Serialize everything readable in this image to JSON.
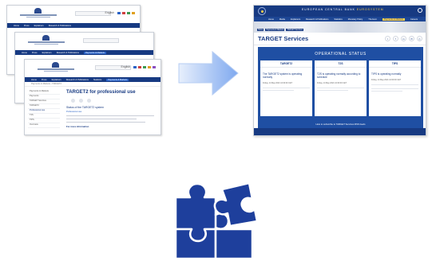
{
  "old_site": {
    "bank_name": "EUROPEAN CENTRAL BANK",
    "bank_subtitle": "EUROSYSTEM",
    "language": "English",
    "nav": [
      "Home",
      "Press",
      "Explainers",
      "Research & Publications",
      "Statistics",
      "Monetary Policy",
      "The Euro",
      "Payments & Markets",
      "Careers"
    ],
    "breadcrumb": "Payments & Markets › TARGET2",
    "sidebar": [
      "Payments & Markets",
      "Payments",
      "TARGET Services",
      "TARGET2",
      "Profile",
      "Professional use",
      "T2S",
      "TIPS",
      "Overview"
    ],
    "title": "TARGET2 for professional use",
    "status_heading": "Status of the TARGET2 system",
    "status_link": "Professional use",
    "more_link": "For more information"
  },
  "new_site": {
    "bank_name": "EUROPEAN CENTRAL BANK",
    "bank_subtitle": "EUROSYSTEM",
    "nav": [
      "Home",
      "Media",
      "Explainers",
      "Research & Publications",
      "Statistics",
      "Monetary Policy",
      "The Euro",
      "Payments & Markets",
      "Careers"
    ],
    "breadcrumb": [
      "Home",
      "Payments & Markets",
      "TARGET Services"
    ],
    "page_title": "TARGET Services",
    "operational_status_title": "OPERATIONAL STATUS",
    "cards": [
      {
        "name": "TARGET2",
        "message": "The TARGET2 system is operating normally",
        "date": "Friday, 14 May 2021 10:00:00 CET"
      },
      {
        "name": "T2S",
        "message": "T2S is operating normally according to schedule",
        "date": "Friday, 14 May 2021 10:00:00 CET"
      },
      {
        "name": "TIPS",
        "message": "TIPS is operating normally",
        "date": "Friday, 14 May 2021 10:00:00 CET"
      }
    ],
    "subscribe_text": "How to subscribe to TARGET Services RSS feeds"
  },
  "colors": {
    "ecb_blue": "#173a82",
    "panel_blue": "#1f4fa3",
    "accent_yellow": "#ffd24a",
    "puzzle_blue": "#1e3f9c",
    "arrow_light": "#d9e6fb",
    "arrow_dark": "#7fa9ef"
  }
}
